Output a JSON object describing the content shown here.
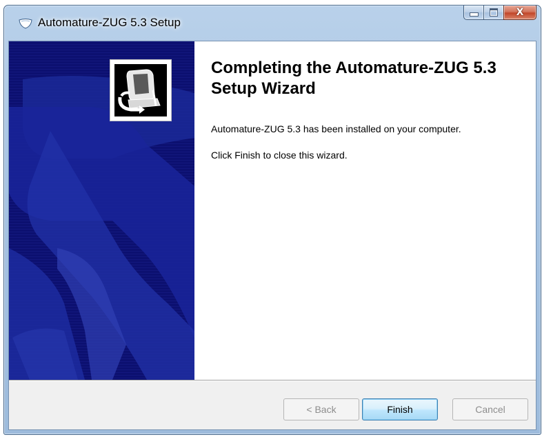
{
  "window": {
    "title": "Automature-ZUG 5.3 Setup",
    "icon": "installer-shield-icon",
    "caption_buttons": {
      "minimize_icon": "minimize-icon",
      "maximize_icon": "maximize-icon",
      "close_icon": "close-icon",
      "close_glyph": "X"
    }
  },
  "banner": {
    "logo_icon": "installer-computer-icon",
    "background_color": "#0c1070"
  },
  "main": {
    "heading": "Completing the Automature-ZUG 5.3 Setup Wizard",
    "installed_message": "Automature-ZUG 5.3 has been installed on your computer.",
    "instruction": "Click Finish to close this wizard."
  },
  "buttons": {
    "back_label": "< Back",
    "finish_label": "Finish",
    "cancel_label": "Cancel"
  },
  "colors": {
    "accent_button_border": "#3c7fb1",
    "close_button": "#c2472a",
    "disabled_text": "#8d8d8d"
  }
}
